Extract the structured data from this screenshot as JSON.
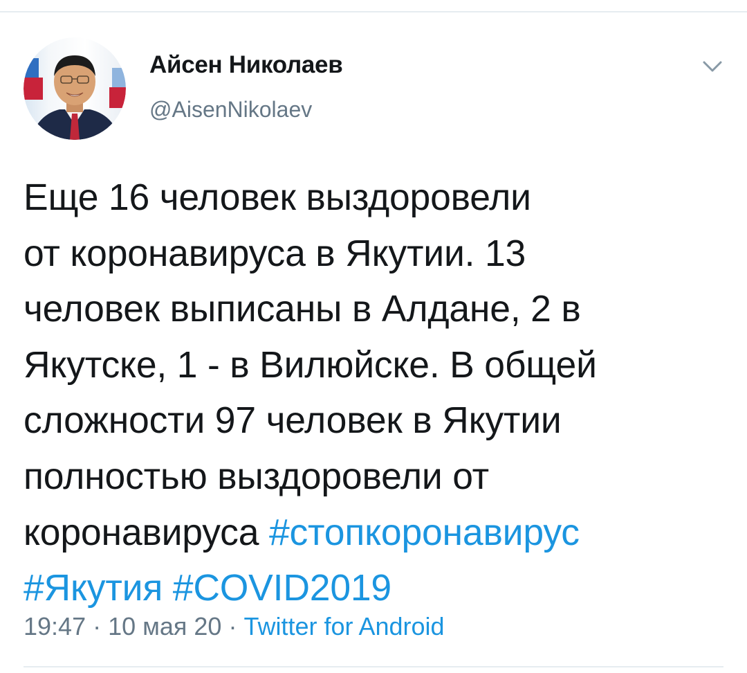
{
  "tweet": {
    "display_name": "Айсен Николаев",
    "handle": "@AisenNikolaev",
    "text_lines": [
      "Еще 16 человек выздоровели",
      "от коронавируса в Якутии. 13",
      "человек выписаны в Алдане, 2 в",
      "Якутске, 1 - в Вилюйске. В общей",
      "сложности 97 человек в Якутии",
      "полностью выздоровели от"
    ],
    "last_line_text": "коронавируса ",
    "hashtags": [
      "#стопкоронавирус",
      "#Якутия",
      "#COVID2019"
    ],
    "time": "19:47",
    "date": "10 мая 20",
    "separator": " · ",
    "source": "Twitter for Android"
  },
  "icons": {
    "menu": "chevron-down-icon",
    "avatar": "user-avatar"
  },
  "colors": {
    "link": "#1b95e0",
    "secondary_text": "#657786",
    "primary_text": "#14171a",
    "divider": "#e6ecf0"
  }
}
